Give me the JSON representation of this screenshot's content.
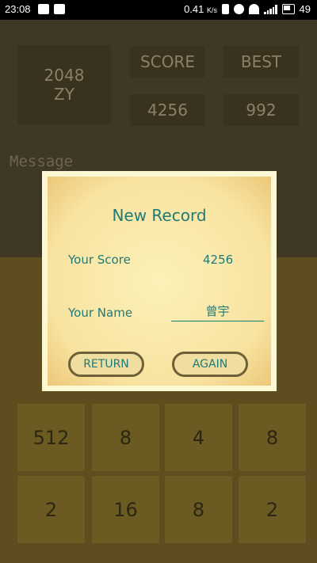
{
  "status_bar": {
    "time": "23:08",
    "network_speed": "0.41",
    "speed_unit": "K/s",
    "battery": "49"
  },
  "game": {
    "logo_line1": "2048",
    "logo_line2": "ZY",
    "score_label": "SCORE",
    "best_label": "BEST",
    "score_value": "4256",
    "best_value": "992",
    "message_label": "Message",
    "tiles_row4": [
      "512",
      "8",
      "4",
      "8"
    ],
    "tiles_row5": [
      "2",
      "16",
      "8",
      "2"
    ]
  },
  "dialog": {
    "title": "New Record",
    "score_label": "Your Score",
    "score_value": "4256",
    "name_label": "Your Name",
    "name_value": "曾宇",
    "return_label": "RETURN",
    "again_label": "AGAIN"
  },
  "colors": {
    "accent_text": "#207a78",
    "button_border": "#6e5f38",
    "paper": "#fcf1b8"
  }
}
